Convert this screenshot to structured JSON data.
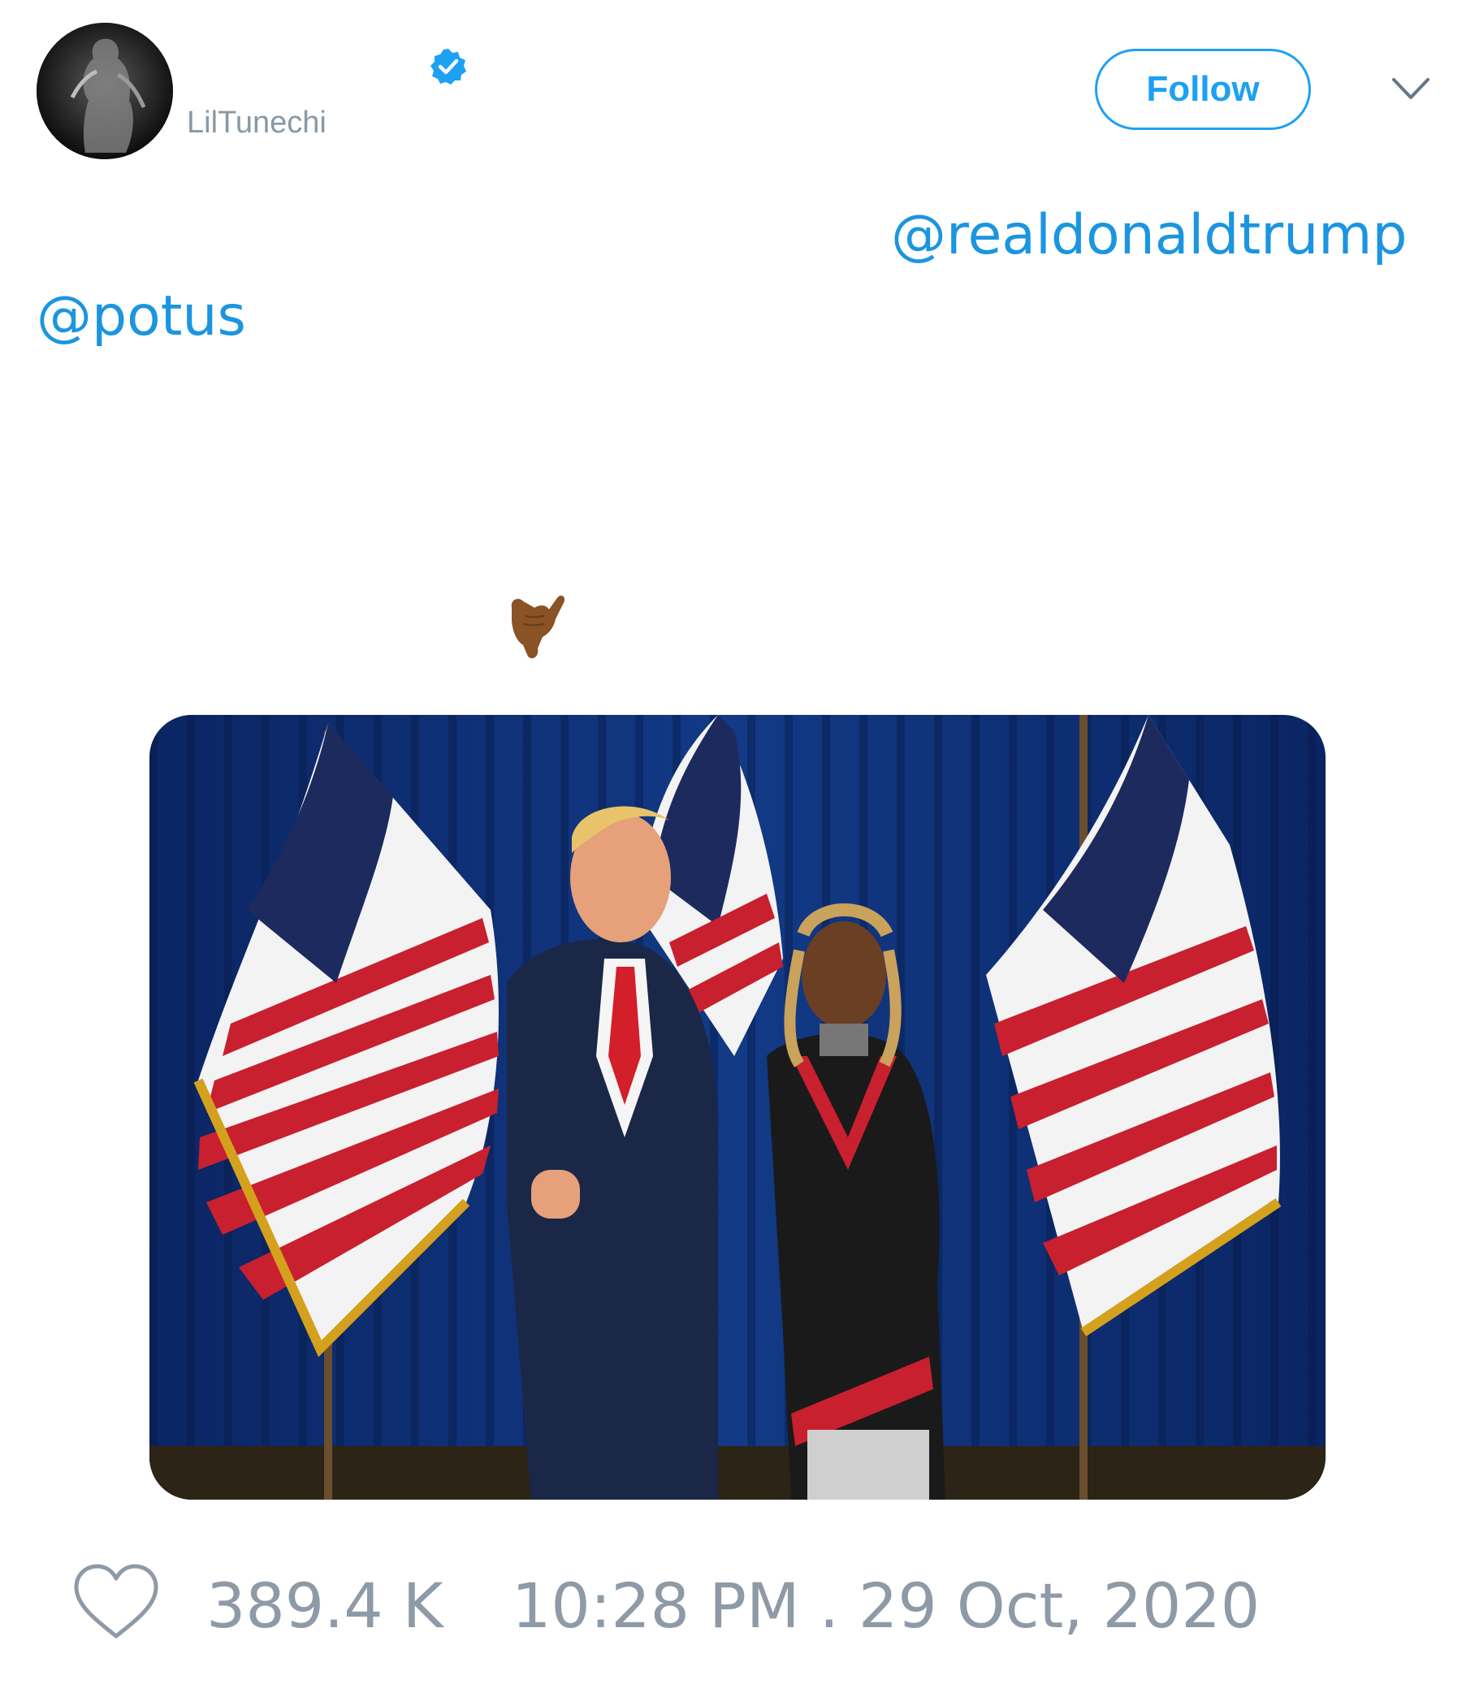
{
  "user": {
    "handle": "LilTunechi",
    "verified": true
  },
  "header": {
    "follow_label": "Follow",
    "menu_icon": "chevron-down-icon"
  },
  "tweet": {
    "mentions": [
      "@realdonaldtrump",
      "@potus"
    ],
    "emoji": "call-me-hand-emoji",
    "media_alt": "photo"
  },
  "footer": {
    "likes": "389.4 K",
    "timestamp": "10:28 PM . 29 Oct, 2020"
  },
  "colors": {
    "accent": "#1da1f2",
    "link": "#1b95e0",
    "muted": "#8899a6",
    "flag_red": "#c8202e",
    "flag_blue": "#1c2a5e",
    "backdrop": "#0e2c6b"
  }
}
